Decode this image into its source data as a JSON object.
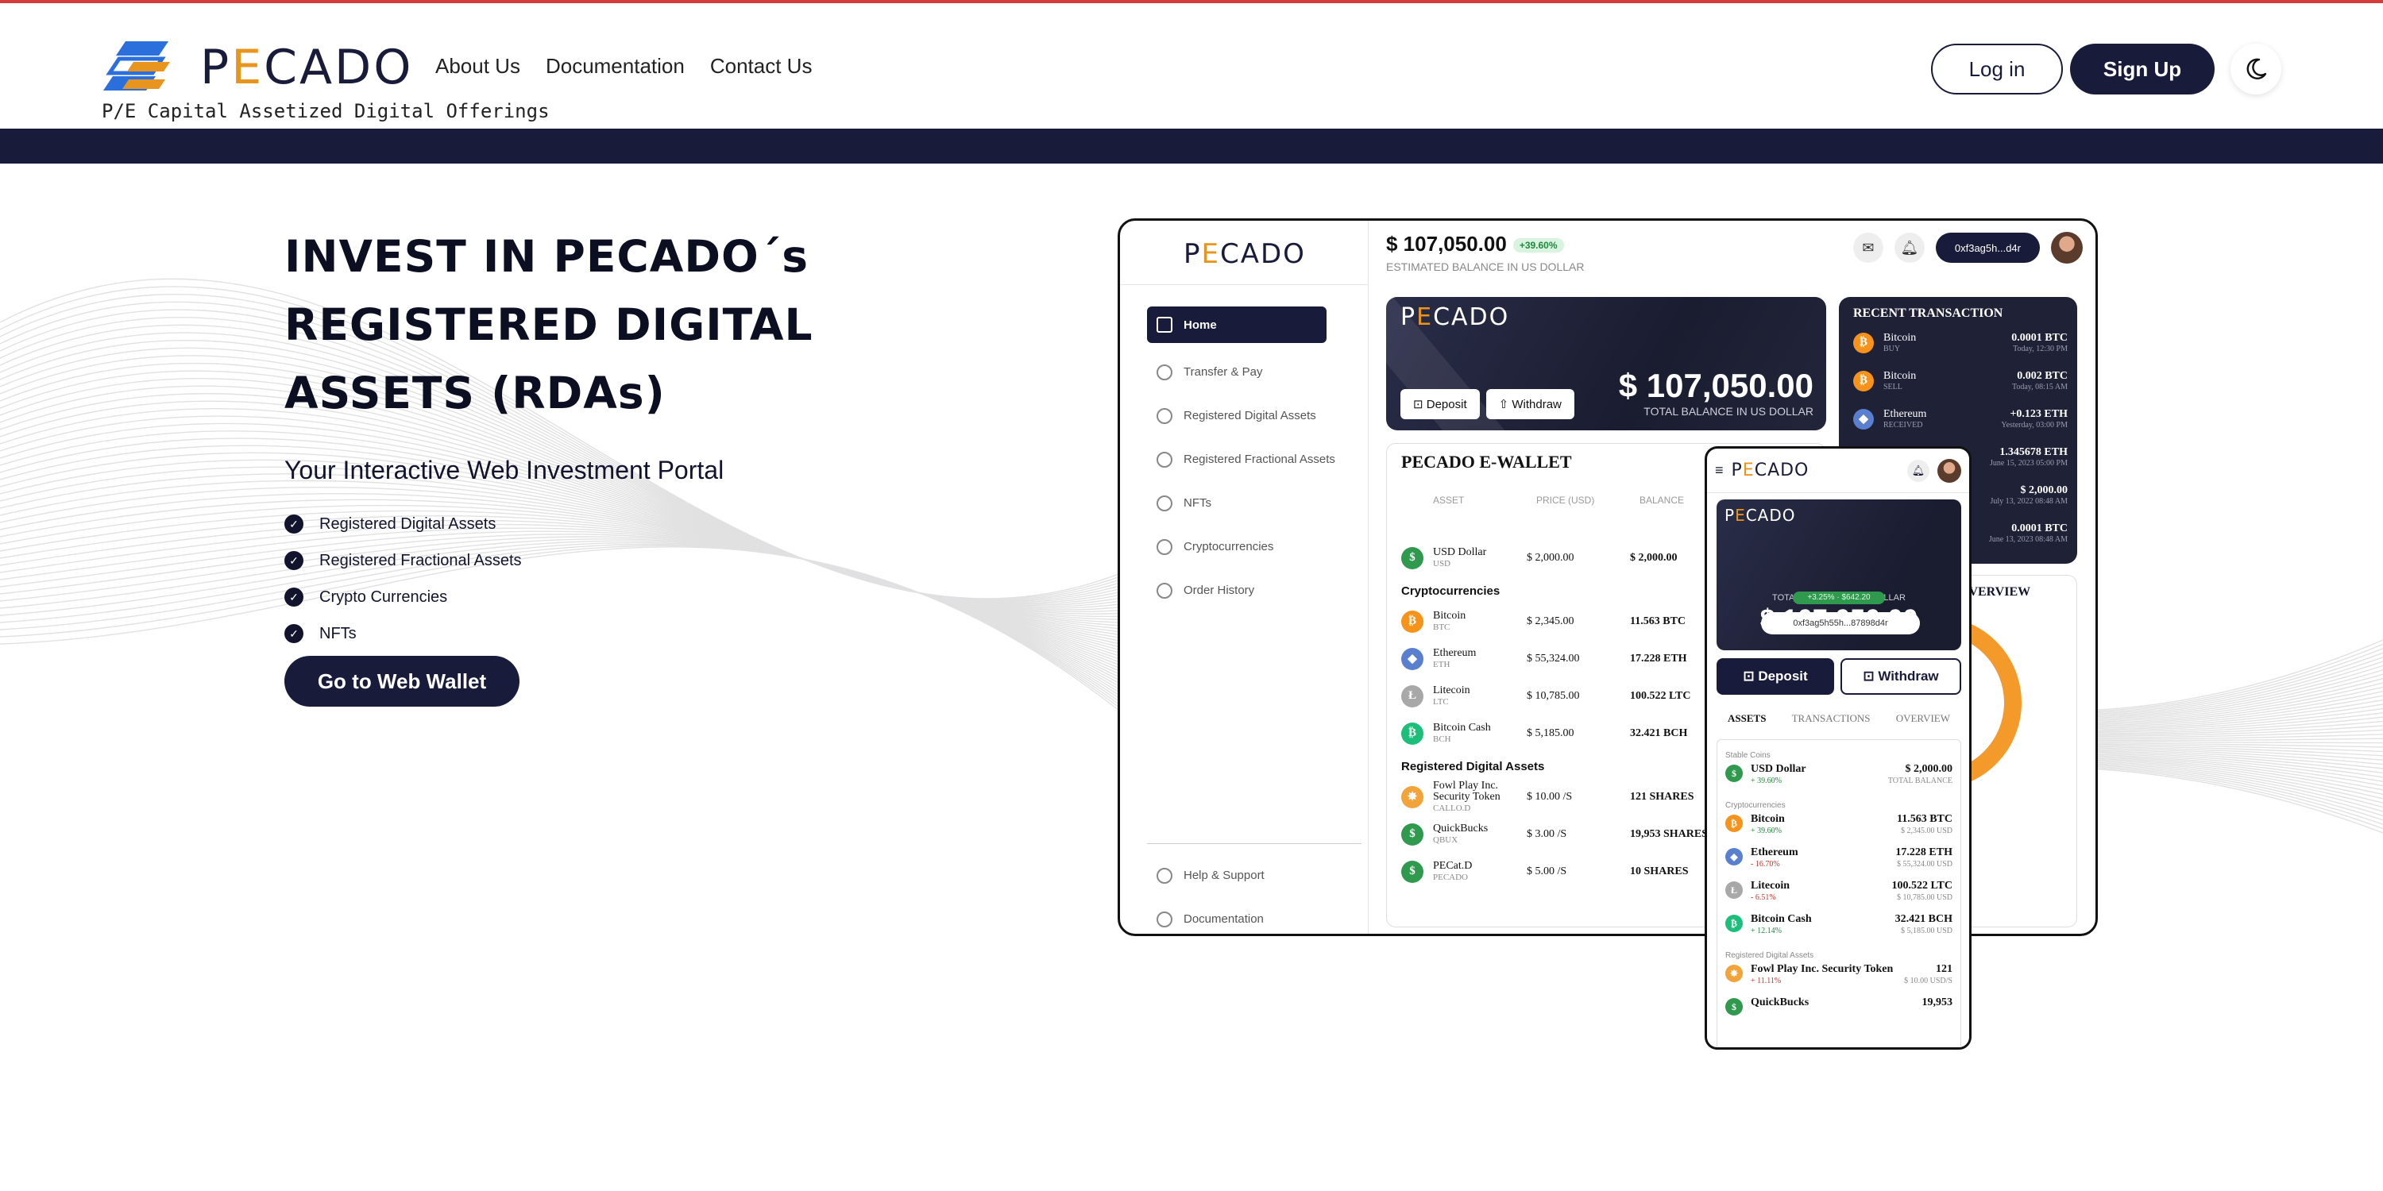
{
  "brand": {
    "name_prefix": "P",
    "name_e": "E",
    "name_suffix": "CADO",
    "tagline": "P/E Capital Assetized Digital Offerings",
    "accent": "#e8951f",
    "navy": "#191b3a"
  },
  "nav": {
    "items": [
      "About Us",
      "Documentation",
      "Contact Us"
    ],
    "login": "Log in",
    "signup": "Sign Up",
    "theme_icon": "moon-icon"
  },
  "hero": {
    "title_line1": "INVEST IN PECADO´s",
    "title_line2": "REGISTERED DIGITAL",
    "title_line3": "ASSETS (RDAs)",
    "subtitle": "Your Interactive Web Investment Portal",
    "features": [
      "Registered Digital Assets",
      "Registered Fractional Assets",
      "Crypto Currencies",
      "NFTs"
    ],
    "cta": "Go to Web Wallet"
  },
  "desktop": {
    "menu": [
      "Home",
      "Transfer & Pay",
      "Registered Digital Assets",
      "Registered Fractional Assets",
      "NFTs",
      "Cryptocurrencies",
      "Order History"
    ],
    "menu_bottom": [
      "Help & Support",
      "Documentation"
    ],
    "balance": "$ 107,050.00",
    "balance_pct": "+39.60%",
    "balance_sub": "ESTIMATED BALANCE IN US DOLLAR",
    "address": "0xf3ag5h...d4r",
    "card_amount": "$ 107,050.00",
    "card_sub": "TOTAL BALANCE IN US DOLLAR",
    "deposit": "Deposit",
    "withdraw": "Withdraw",
    "ewallet_title": "PECADO E-WALLET",
    "ewallet_head": [
      "ASSET",
      "PRICE (USD)",
      "BALANCE"
    ],
    "stable": {
      "name": "USD Dollar",
      "sym": "USD",
      "price": "$ 2,000.00",
      "bal": "$ 2,000.00"
    },
    "crypto_title": "Cryptocurrencies",
    "crypto": [
      {
        "name": "Bitcoin",
        "sym": "BTC",
        "price": "$ 2,345.00",
        "bal": "11.563 BTC",
        "color": "#f7931a",
        "glyph": "₿"
      },
      {
        "name": "Ethereum",
        "sym": "ETH",
        "price": "$ 55,324.00",
        "bal": "17.228 ETH",
        "color": "#5b7fcf",
        "glyph": "◆"
      },
      {
        "name": "Litecoin",
        "sym": "LTC",
        "price": "$ 10,785.00",
        "bal": "100.522 LTC",
        "color": "#a8a8a8",
        "glyph": "Ł"
      },
      {
        "name": "Bitcoin Cash",
        "sym": "BCH",
        "price": "$ 5,185.00",
        "bal": "32.421 BCH",
        "color": "#1cbf7a",
        "glyph": "₿"
      }
    ],
    "rda_title": "Registered Digital Assets",
    "rda": [
      {
        "name": "Fowl Play Inc. Security Token",
        "sym": "CALLO.D",
        "price": "$ 10.00 /S",
        "bal": "121 SHARES",
        "color": "#f2a33a",
        "glyph": "✸"
      },
      {
        "name": "QuickBucks",
        "sym": "QBUX",
        "price": "$ 3.00 /S",
        "bal": "19,953 SHARES",
        "color": "#2f9a4d",
        "glyph": "$"
      },
      {
        "name": "PECat.D",
        "sym": "PECADO",
        "price": "$ 5.00 /S",
        "bal": "10 SHARES",
        "color": "#2f9a4d",
        "glyph": "$"
      }
    ],
    "recent_title": "RECENT TRANSACTION",
    "recent": [
      {
        "name": "Bitcoin",
        "sub": "BUY",
        "amt": "0.0001 BTC",
        "when": "Today, 12:30 PM",
        "color": "#f7931a",
        "glyph": "₿"
      },
      {
        "name": "Bitcoin",
        "sub": "SELL",
        "amt": "0.002 BTC",
        "when": "Today, 08:15 AM",
        "color": "#f7931a",
        "glyph": "₿"
      },
      {
        "name": "Ethereum",
        "sub": "RECEIVED",
        "amt": "+0.123 ETH",
        "when": "Yesterday, 03:00 PM",
        "color": "#5b7fcf",
        "glyph": "◆"
      },
      {
        "name": "",
        "sub": "",
        "amt": "1.345678 ETH",
        "when": "June 15, 2023 05:00 PM",
        "color": "",
        "glyph": ""
      },
      {
        "name": "",
        "sub": "",
        "amt": "$ 2,000.00",
        "when": "July 13, 2022 08:48 AM",
        "color": "",
        "glyph": ""
      },
      {
        "name": "",
        "sub": "",
        "amt": "0.0001 BTC",
        "when": "June 13, 2023 08:48 AM",
        "color": "",
        "glyph": ""
      }
    ],
    "overview_title": "OVERVIEW"
  },
  "mobile": {
    "balance_label": "TOTAL BALANCE IN US DOLLAR",
    "balance": "$ 107,050.00",
    "pct": "+3.25% · $642.20",
    "address": "0xf3ag5h55h...87898d4r",
    "deposit": "Deposit",
    "withdraw": "Withdraw",
    "tabs": [
      "ASSETS",
      "TRANSACTIONS",
      "OVERVIEW"
    ],
    "stable_label": "Stable Coins",
    "stable": {
      "name": "USD Dollar",
      "pct": "+ 39.60%",
      "amt": "$ 2,000.00",
      "sub": "TOTAL BALANCE"
    },
    "crypto_label": "Cryptocurrencies",
    "crypto": [
      {
        "name": "Bitcoin",
        "pct": "+ 39.60%",
        "amt": "11.563 BTC",
        "sub": "$ 2,345.00 USD",
        "dir": "up",
        "color": "#f7931a",
        "glyph": "₿"
      },
      {
        "name": "Ethereum",
        "pct": "- 16.70%",
        "amt": "17.228 ETH",
        "sub": "$ 55,324.00 USD",
        "dir": "down",
        "color": "#5b7fcf",
        "glyph": "◆"
      },
      {
        "name": "Litecoin",
        "pct": "- 6.51%",
        "amt": "100.522 LTC",
        "sub": "$ 10,785.00 USD",
        "dir": "down",
        "color": "#a8a8a8",
        "glyph": "Ł"
      },
      {
        "name": "Bitcoin Cash",
        "pct": "+ 12.14%",
        "amt": "32.421 BCH",
        "sub": "$ 5,185.00 USD",
        "dir": "up",
        "color": "#1cbf7a",
        "glyph": "₿"
      }
    ],
    "rda_label": "Registered Digital Assets",
    "rda": [
      {
        "name": "Fowl Play Inc. Security Token",
        "pct": "+ 11.11%",
        "amt": "121",
        "sub": "$ 10.00 USD/S",
        "dir": "down",
        "color": "#f2a33a",
        "glyph": "✸"
      },
      {
        "name": "QuickBucks",
        "pct": "",
        "amt": "19,953",
        "sub": "",
        "dir": "up",
        "color": "#2f9a4d",
        "glyph": "$"
      }
    ]
  }
}
